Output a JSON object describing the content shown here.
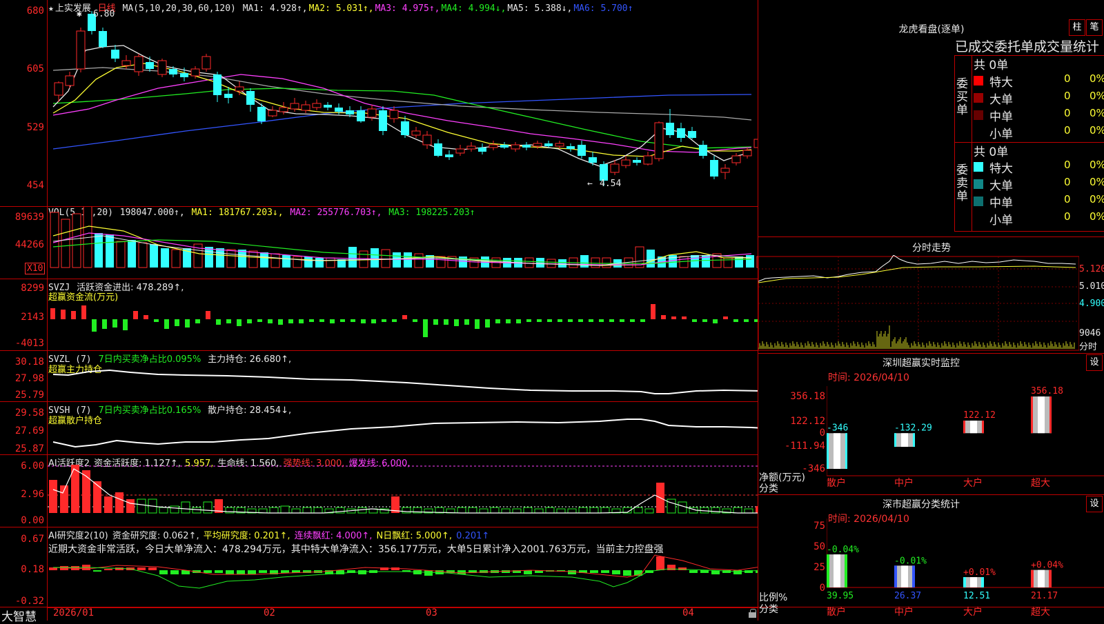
{
  "stock": {
    "name_prefix": "★",
    "name": "上实发展",
    "period": "日线"
  },
  "main": {
    "ma_label": "MA(5,10,20,30,60,120)",
    "ma": [
      {
        "name": "MA1:",
        "value": "4.928↑",
        "color": "#e8e8e8"
      },
      {
        "name": "MA2:",
        "value": "5.031↑",
        "color": "#ffff33"
      },
      {
        "name": "MA3:",
        "value": "4.975↑",
        "color": "#ff40ff"
      },
      {
        "name": "MA4:",
        "value": "4.994↓",
        "color": "#22ee22"
      },
      {
        "name": "MA5:",
        "value": "5.388↓",
        "color": "#e8e8e8"
      },
      {
        "name": "MA6:",
        "value": "5.700↑",
        "color": "#3355ff"
      }
    ],
    "axis": [
      "680",
      "605",
      "529",
      "454"
    ],
    "high_mark": "6.80",
    "low_mark": "4.54"
  },
  "vol": {
    "label": "VOL(5,10,20)",
    "value": "198047.000↑,",
    "ma1": "MA1: 181767.203↓,",
    "ma2": "MA2: 255776.703↑,",
    "ma3": "MA3: 198225.203↑",
    "axis": [
      "89639",
      "44266"
    ],
    "unit": "X10"
  },
  "svzj": {
    "label": "SVZJ",
    "text": "活跃资金进出: 478.289↑,",
    "title": "超赢资金流(万元)",
    "axis": [
      "8299",
      "2143",
      "-4013"
    ]
  },
  "svzl": {
    "label": "SVZL (7)",
    "ratio": "7日内买卖净占比0.095%",
    "hold": "主力持仓: 26.680↑,",
    "title": "超赢主力持仓",
    "axis": [
      "30.18",
      "27.98",
      "25.79"
    ]
  },
  "svsh": {
    "label": "SVSH (7)",
    "ratio": "7日内买卖净占比0.165%",
    "hold": "散户持仓: 28.454↓,",
    "title": "超赢散户持仓",
    "axis": [
      "29.58",
      "27.69",
      "25.87"
    ]
  },
  "ai1": {
    "label": "AI活跃度2",
    "a": "资金活跃度: 1.127↑,",
    "b": "5.957,",
    "c": "生命线: 1.560,",
    "d": "强势线: 3.000,",
    "e": "爆发线: 6.000,",
    "axis": [
      "6.00",
      "2.96",
      "0.00"
    ]
  },
  "ai2": {
    "label": "AI研究度2(10)",
    "a": "资金研究度: 0.062↑,",
    "b": "平均研究度: 0.201↑,",
    "c": "连续飘红: 4.000↑,",
    "d": "N日飘红: 5.000↑,",
    "e": "0.201↑",
    "summary": "近期大资金非常活跃，今日大单净流入：478.294万元，其中特大单净流入：356.177万元，大单5日累计净入2001.763万元，当前主力控盘强",
    "axis": [
      "0.67",
      "0.18",
      "-0.32"
    ]
  },
  "xaxis": [
    "2026/01",
    "02",
    "03",
    "04"
  ],
  "brand": "大智慧",
  "lh": {
    "title": "龙虎看盘(逐单)",
    "btn1": "柱",
    "btn2": "笔",
    "heading": "已成交委托单成交量统计",
    "buy_label": "委买单",
    "sell_label": "委卖单",
    "buy_total": "共 0单",
    "sell_total": "共 0单",
    "buy_rows": [
      {
        "name": "特大",
        "count": "0",
        "pct": "0%",
        "color": "#ff0000"
      },
      {
        "name": "大单",
        "count": "0",
        "pct": "0%",
        "color": "#990000"
      },
      {
        "name": "中单",
        "count": "0",
        "pct": "0%",
        "color": "#660000"
      },
      {
        "name": "小单",
        "count": "0",
        "pct": "0%",
        "color": ""
      }
    ],
    "sell_rows": [
      {
        "name": "特大",
        "count": "0",
        "pct": "0%",
        "color": "#33ffff"
      },
      {
        "name": "大单",
        "count": "0",
        "pct": "0%",
        "color": "#118888"
      },
      {
        "name": "中单",
        "count": "0",
        "pct": "0%",
        "color": "#0d6f6f"
      },
      {
        "name": "小单",
        "count": "0",
        "pct": "0%",
        "color": ""
      }
    ]
  },
  "ts": {
    "title": "分时走势",
    "axis": [
      "5.120",
      "5.010",
      "4.900",
      "9046",
      "分时"
    ]
  },
  "sz": {
    "title": "深圳超赢实时监控",
    "btn": "设",
    "time": "时间: 2026/04/10",
    "axis": [
      "356.18",
      "122.12",
      "0",
      "-111.94",
      "-346"
    ],
    "unit": "净额(万元)",
    "cat_label": "分类",
    "chart_data": {
      "type": "bar",
      "categories": [
        "散户",
        "中户",
        "大户",
        "超大"
      ],
      "values": [
        -346,
        -132.29,
        122.12,
        356.18
      ],
      "labels": [
        "-346",
        "-132.29",
        "122.12",
        "356.18"
      ],
      "ylim": [
        -346,
        356.18
      ]
    }
  },
  "sc": {
    "title": "深市超赢分类统计",
    "btn": "设",
    "time": "时间: 2026/04/10",
    "axis": [
      "75",
      "50",
      "25",
      "0"
    ],
    "unit": "比例%",
    "cat_label": "分类",
    "chart_data": {
      "type": "bar",
      "categories": [
        "散户",
        "中户",
        "大户",
        "超大"
      ],
      "values": [
        39.95,
        26.37,
        12.51,
        21.17
      ],
      "changes": [
        "-0.04%",
        "-0.01%",
        "+0.01%",
        "+0.04%"
      ],
      "ylim": [
        0,
        75
      ]
    }
  }
}
